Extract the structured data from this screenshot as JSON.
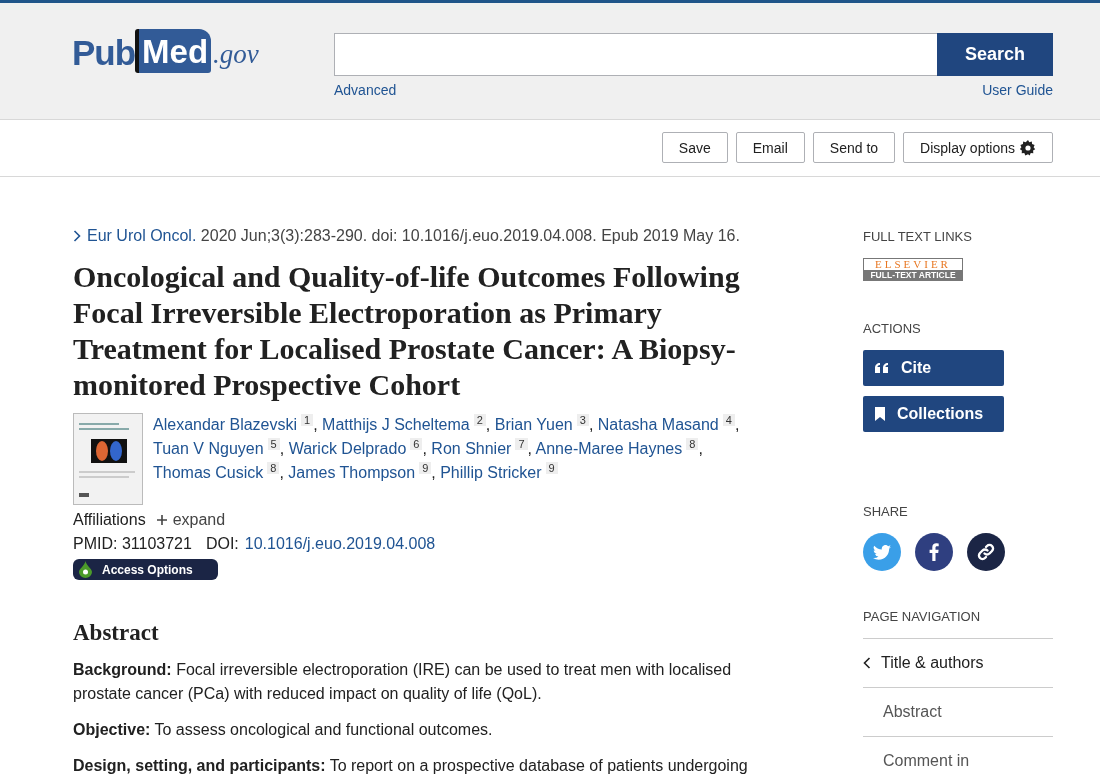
{
  "header": {
    "logo": {
      "left": "Pub",
      "mark": "Med",
      "suffix": ".gov"
    },
    "search": {
      "button": "Search"
    },
    "links": [
      "Advanced",
      "User Guide"
    ]
  },
  "toolbar": {
    "buttons": [
      {
        "label": "Save",
        "kind": "plain"
      },
      {
        "label": "Email",
        "kind": "plain"
      },
      {
        "label": "Send to",
        "kind": "plain"
      },
      {
        "label": "Display options",
        "kind": "gear"
      }
    ]
  },
  "citation": {
    "journal": "Eur Urol Oncol.",
    "details": "2020 Jun;3(3):283-290. doi: 10.1016/j.euo.2019.04.008. Epub 2019 May 16."
  },
  "title": "Oncological and Quality-of-life Outcomes Following Focal Irreversible Electroporation as Primary Treatment for Localised Prostate Cancer: A Biopsy-monitored Prospective Cohort",
  "authors": [
    {
      "name": "Alexandar Blazevski",
      "aff": "1",
      "sep": ","
    },
    {
      "name": "Matthijs J Scheltema",
      "aff": "2",
      "sep": ","
    },
    {
      "name": "Brian Yuen",
      "aff": "3",
      "sep": ","
    },
    {
      "name": "Natasha Masand",
      "aff": "4",
      "sep": ","
    },
    {
      "name": "Tuan V Nguyen",
      "aff": "5",
      "sep": ","
    },
    {
      "name": "Warick Delprado",
      "aff": "6",
      "sep": ","
    },
    {
      "name": "Ron Shnier",
      "aff": "7",
      "sep": ","
    },
    {
      "name": "Anne-Maree Haynes",
      "aff": "8",
      "sep": ","
    },
    {
      "name": "Thomas Cusick",
      "aff": "8",
      "sep": ","
    },
    {
      "name": "James Thompson",
      "aff": "9",
      "sep": ","
    },
    {
      "name": "Phillip Stricker",
      "aff": "9"
    }
  ],
  "affiliations": {
    "label": "Affiliations",
    "toggle": "expand",
    "expanded": false
  },
  "ids": {
    "pmid_label": "PMID:",
    "pmid": "31103721",
    "doi_label": "DOI:",
    "doi": "10.1016/j.euo.2019.04.008"
  },
  "access": "Access Options",
  "abstract": {
    "heading": "Abstract",
    "paragraphs": [
      {
        "label": "Background:",
        "text": "Focal irreversible electroporation (IRE) can be used to treat men with localised prostate cancer (PCa) with reduced impact on quality of life (QoL)."
      },
      {
        "label": "Objective:",
        "text": "To assess oncological and functional outcomes."
      },
      {
        "label": "Design, setting, and participants:",
        "text": "To report on a prospective database of patients undergoing"
      }
    ]
  },
  "sidebar": {
    "full_text": {
      "heading": "FULL TEXT LINKS",
      "badge_top": "ELSEVIER",
      "badge_bottom": "FULL-TEXT ARTICLE"
    },
    "actions": {
      "heading": "ACTIONS",
      "buttons": [
        {
          "label": "Cite",
          "kind": "quote"
        },
        {
          "label": "Collections",
          "kind": "bookmark"
        }
      ]
    },
    "share": {
      "heading": "SHARE",
      "items": [
        {
          "kind": "twitter",
          "color": "#3a9fe8"
        },
        {
          "kind": "facebook",
          "color": "#2f3f80"
        },
        {
          "kind": "link",
          "color": "#1b2545"
        }
      ]
    },
    "nav": {
      "heading": "PAGE NAVIGATION",
      "items": [
        {
          "label": "Title & authors",
          "selected": true
        },
        {
          "label": "Abstract",
          "selected": false
        },
        {
          "label": "Comment in",
          "selected": false
        }
      ]
    }
  }
}
